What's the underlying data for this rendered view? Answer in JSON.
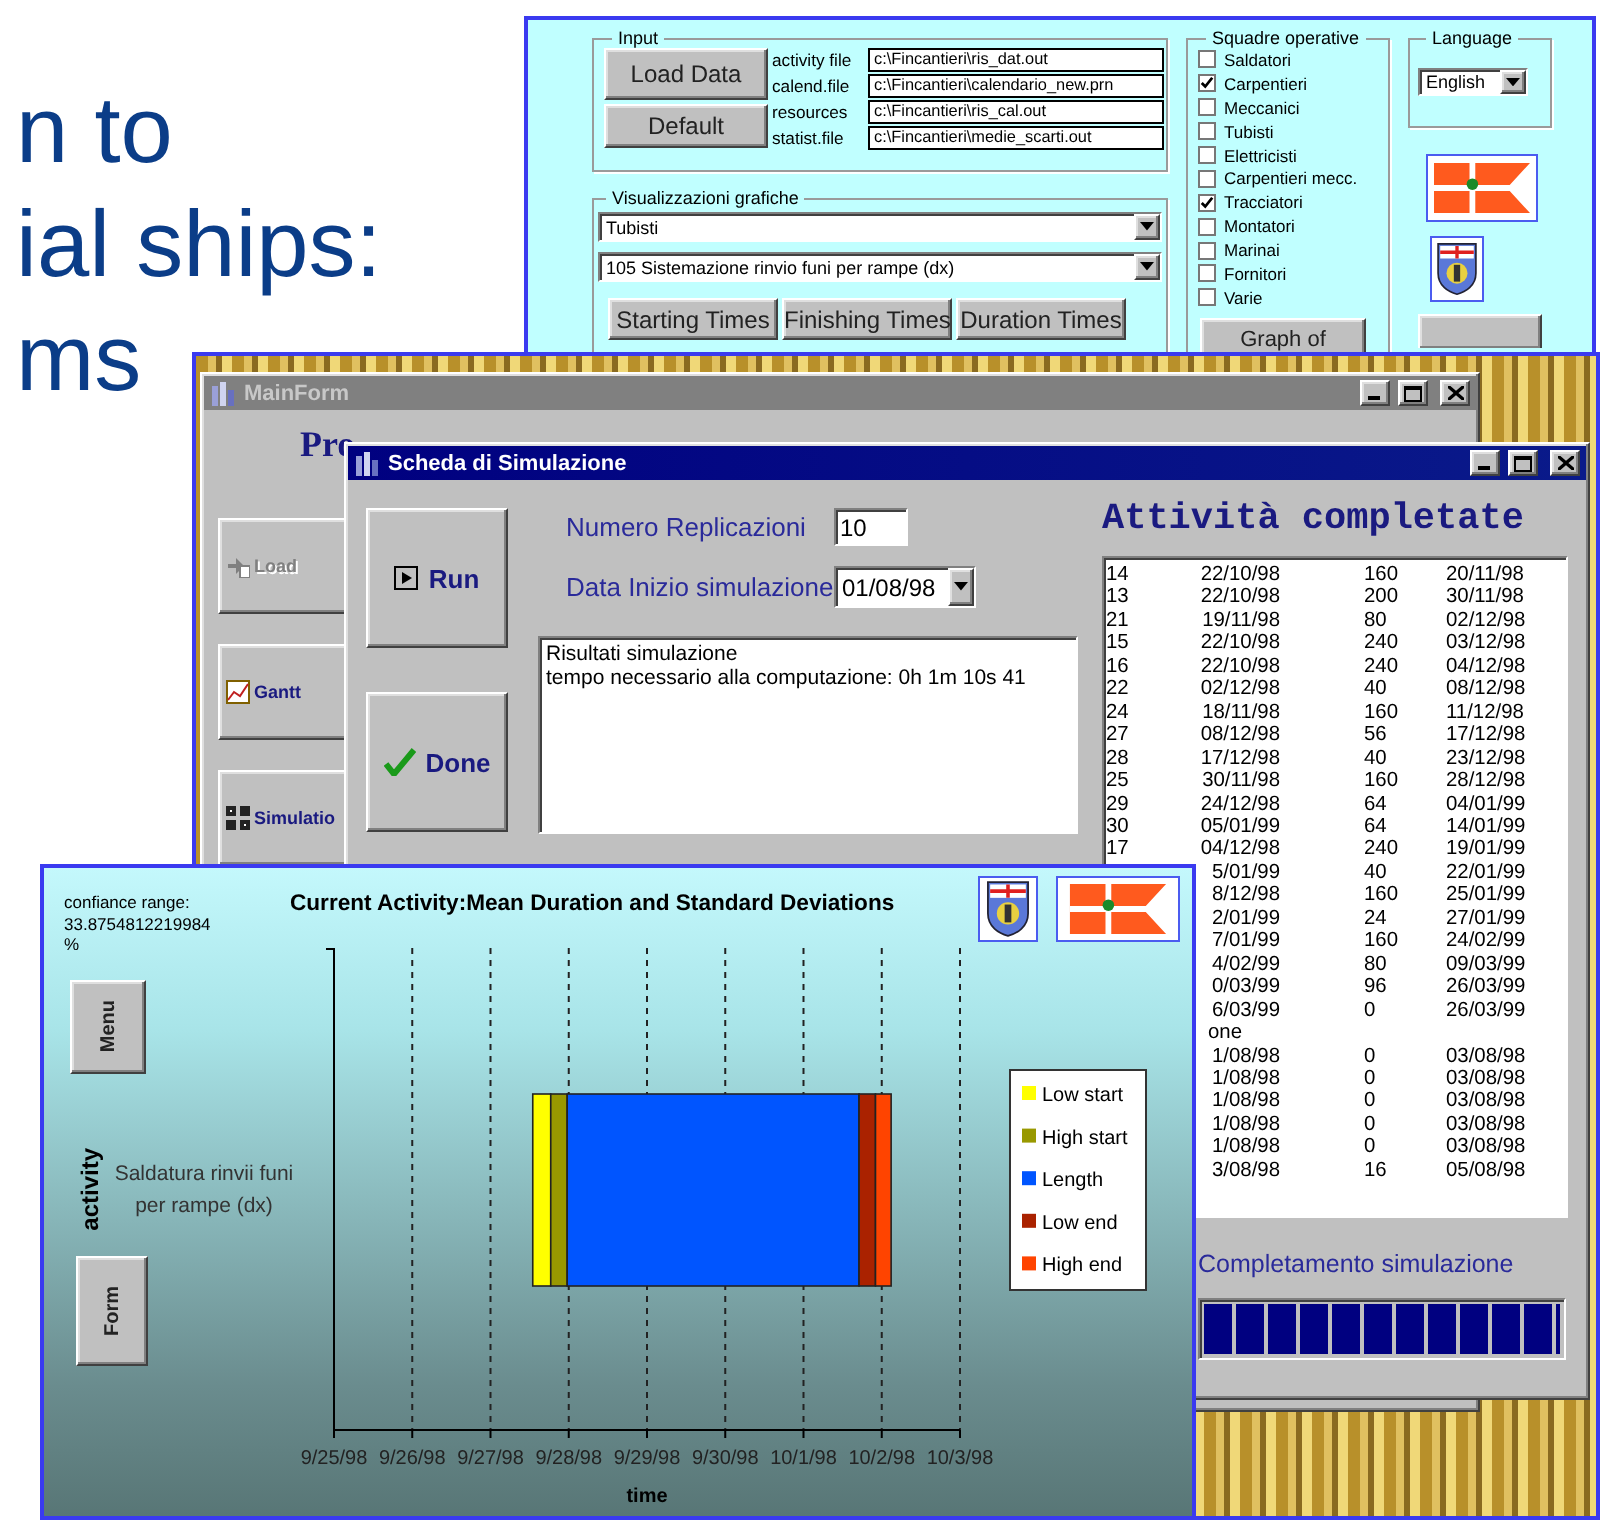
{
  "slide": {
    "title_lines": [
      "n to",
      "ial ships:",
      "ms"
    ]
  },
  "setup_window": {
    "input_group": {
      "title": "Input",
      "buttons": [
        "Load Data",
        "Default"
      ],
      "files": [
        {
          "label": "activity file",
          "value": "c:\\Fincantieri\\ris_dat.out"
        },
        {
          "label": "calend.file",
          "value": "c:\\Fincantieri\\calendario_new.prn"
        },
        {
          "label": "resources",
          "value": "c:\\Fincantieri\\ris_cal.out"
        },
        {
          "label": "statist.file",
          "value": "c:\\Fincantieri\\medie_scarti.out"
        }
      ]
    },
    "charts_group": {
      "title": "Visualizzazioni grafiche",
      "selects": [
        "Tubisti",
        "105 Sistemazione rinvio funi per rampe (dx)"
      ],
      "buttons": [
        "Starting Times",
        "Finishing Times",
        "Duration Times"
      ]
    },
    "teams_group": {
      "title": "Squadre operative",
      "teams": [
        {
          "label": "Saldatori",
          "checked": false
        },
        {
          "label": "Carpentieri",
          "checked": true
        },
        {
          "label": "Meccanici",
          "checked": false
        },
        {
          "label": "Tubisti",
          "checked": false
        },
        {
          "label": "Elettricisti",
          "checked": false
        },
        {
          "label": "Carpentieri mecc.",
          "checked": false
        },
        {
          "label": "Tracciatori",
          "checked": true
        },
        {
          "label": "Montatori",
          "checked": false
        },
        {
          "label": "Marinai",
          "checked": false
        },
        {
          "label": "Fornitori",
          "checked": false
        },
        {
          "label": "Varie",
          "checked": false
        }
      ],
      "button": "Graph of"
    },
    "language_group": {
      "title": "Language",
      "value": "English"
    }
  },
  "main_form": {
    "title": "MainForm",
    "heading": "Pro",
    "buttons": [
      {
        "label": "Load",
        "disabled": true
      },
      {
        "label": "Gantt",
        "disabled": false
      },
      {
        "label": "Simulatio",
        "disabled": false
      }
    ]
  },
  "simulation_window": {
    "title": "Scheda di Simulazione",
    "run": "Run",
    "done": "Done",
    "fields": [
      {
        "kind": "text",
        "label": "Numero Replicazioni",
        "value": "10"
      },
      {
        "kind": "dropdown",
        "label": "Data Inizio simulazione",
        "value": "01/08/98"
      }
    ],
    "log": [
      "Risultati simulazione",
      "tempo necessario alla computazione: 0h 1m 10s 41"
    ],
    "list_title": "Attività completate",
    "rows": [
      {
        "kind": "data",
        "column_1": "14",
        "column_2": "22/10/98",
        "column_3": "160",
        "column_4": "20/11/98"
      },
      {
        "kind": "data",
        "column_1": "13",
        "column_2": "22/10/98",
        "column_3": "200",
        "column_4": "30/11/98"
      },
      {
        "kind": "data",
        "column_1": "21",
        "column_2": "19/11/98",
        "column_3": "80",
        "column_4": "02/12/98"
      },
      {
        "kind": "data",
        "column_1": "15",
        "column_2": "22/10/98",
        "column_3": "240",
        "column_4": "03/12/98"
      },
      {
        "kind": "data",
        "column_1": "16",
        "column_2": "22/10/98",
        "column_3": "240",
        "column_4": "04/12/98"
      },
      {
        "kind": "data",
        "column_1": "22",
        "column_2": "02/12/98",
        "column_3": "40",
        "column_4": "08/12/98"
      },
      {
        "kind": "data",
        "column_1": "24",
        "column_2": "18/11/98",
        "column_3": "160",
        "column_4": "11/12/98"
      },
      {
        "kind": "data",
        "column_1": "27",
        "column_2": "08/12/98",
        "column_3": "56",
        "column_4": "17/12/98"
      },
      {
        "kind": "data",
        "column_1": "28",
        "column_2": "17/12/98",
        "column_3": "40",
        "column_4": "23/12/98"
      },
      {
        "kind": "data",
        "column_1": "25",
        "column_2": "30/11/98",
        "column_3": "160",
        "column_4": "28/12/98"
      },
      {
        "kind": "data",
        "column_1": "29",
        "column_2": "24/12/98",
        "column_3": "64",
        "column_4": "04/01/99"
      },
      {
        "kind": "data",
        "column_1": "30",
        "column_2": "05/01/99",
        "column_3": "64",
        "column_4": "14/01/99"
      },
      {
        "kind": "data",
        "column_1": "17",
        "column_2": "04/12/98",
        "column_3": "240",
        "column_4": "19/01/99"
      },
      {
        "kind": "data",
        "column_2": "5/01/99",
        "column_3": "40",
        "column_4": "22/01/99"
      },
      {
        "kind": "data",
        "column_2": "8/12/98",
        "column_3": "160",
        "column_4": "25/01/99"
      },
      {
        "kind": "data",
        "column_2": "2/01/99",
        "column_3": "24",
        "column_4": "27/01/99"
      },
      {
        "kind": "data",
        "column_2": "7/01/99",
        "column_3": "160",
        "column_4": "24/02/99"
      },
      {
        "kind": "data",
        "column_2": "4/02/99",
        "column_3": "80",
        "column_4": "09/03/99"
      },
      {
        "kind": "data",
        "column_2": "0/03/99",
        "column_3": "96",
        "column_4": "26/03/99"
      },
      {
        "kind": "data",
        "column_2": "6/03/99",
        "column_3": "0",
        "column_4": "26/03/99"
      },
      {
        "kind": "note",
        "column_2": "one"
      },
      {
        "kind": "data",
        "column_2": "1/08/98",
        "column_3": "0",
        "column_4": "03/08/98"
      },
      {
        "kind": "data",
        "column_2": "1/08/98",
        "column_3": "0",
        "column_4": "03/08/98"
      },
      {
        "kind": "data",
        "column_2": "1/08/98",
        "column_3": "0",
        "column_4": "03/08/98"
      },
      {
        "kind": "data",
        "column_2": "1/08/98",
        "column_3": "0",
        "column_4": "03/08/98"
      },
      {
        "kind": "data",
        "column_2": "1/08/98",
        "column_3": "0",
        "column_4": "03/08/98"
      },
      {
        "kind": "data",
        "column_2": "3/08/98",
        "column_3": "16",
        "column_4": "05/08/98"
      }
    ],
    "progress": {
      "label": "Completamento simulazione",
      "level": 1
    }
  },
  "chart_window": {
    "range_note": [
      "confiance range:",
      "33.8754812219984",
      "%"
    ],
    "buttons": [
      "Menu",
      "Form"
    ],
    "title": "Current Activity:Mean Duration and Standard Deviations",
    "ylabel": "activity",
    "category": "Saldatura rinvii funi per rampe (dx)",
    "tick_labels": [
      "9/25/98",
      "9/26/98",
      "9/27/98",
      "9/28/98",
      "9/29/98",
      "9/30/98",
      "10/1/98",
      "10/2/98",
      "10/3/98"
    ],
    "xlabel": "time",
    "legend": [
      {
        "label": "Low start",
        "color": "#ffff00"
      },
      {
        "label": "High start",
        "color": "#999900"
      },
      {
        "label": "Length",
        "color": "#0055ff"
      },
      {
        "label": "Low end",
        "color": "#aa2200"
      },
      {
        "label": "High end",
        "color": "#ff4400"
      }
    ]
  }
}
